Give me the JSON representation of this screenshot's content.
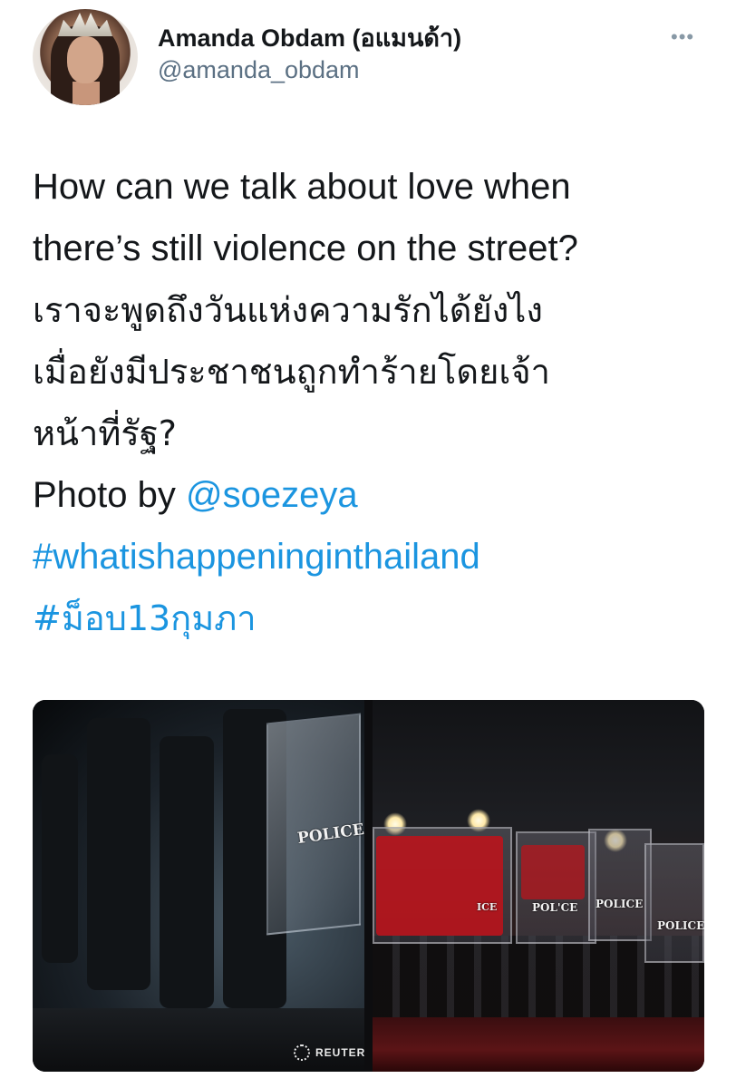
{
  "tweet": {
    "author_name": "Amanda Obdam (อแมนด้า)",
    "author_handle": "@amanda_obdam",
    "more_label": "•••",
    "lines": [
      "How can we talk about love when",
      "there’s still violence on the street?",
      "เราจะพูดถึงวันแห่งความรักได้ยังไง",
      "เมื่อยังมีประชาชนถูกทำร้ายโดยเจ้า",
      "หน้าที่รัฐ?"
    ],
    "photo_credit_prefix": "Photo by ",
    "photo_credit_handle": "@soezeya",
    "hashtags": [
      "#whatishappeninginthailand",
      "#ม็อบ13กุมภา"
    ]
  },
  "media": {
    "left_photo": {
      "shield_text": "POLICE",
      "credit": "REUTERS"
    },
    "right_photo": {
      "shield_texts": [
        "ICE",
        "POL'CE",
        "POLICE",
        "POLICE"
      ]
    }
  },
  "colors": {
    "text": "#14171a",
    "handle": "#5b7083",
    "link": "#1b95e0"
  }
}
